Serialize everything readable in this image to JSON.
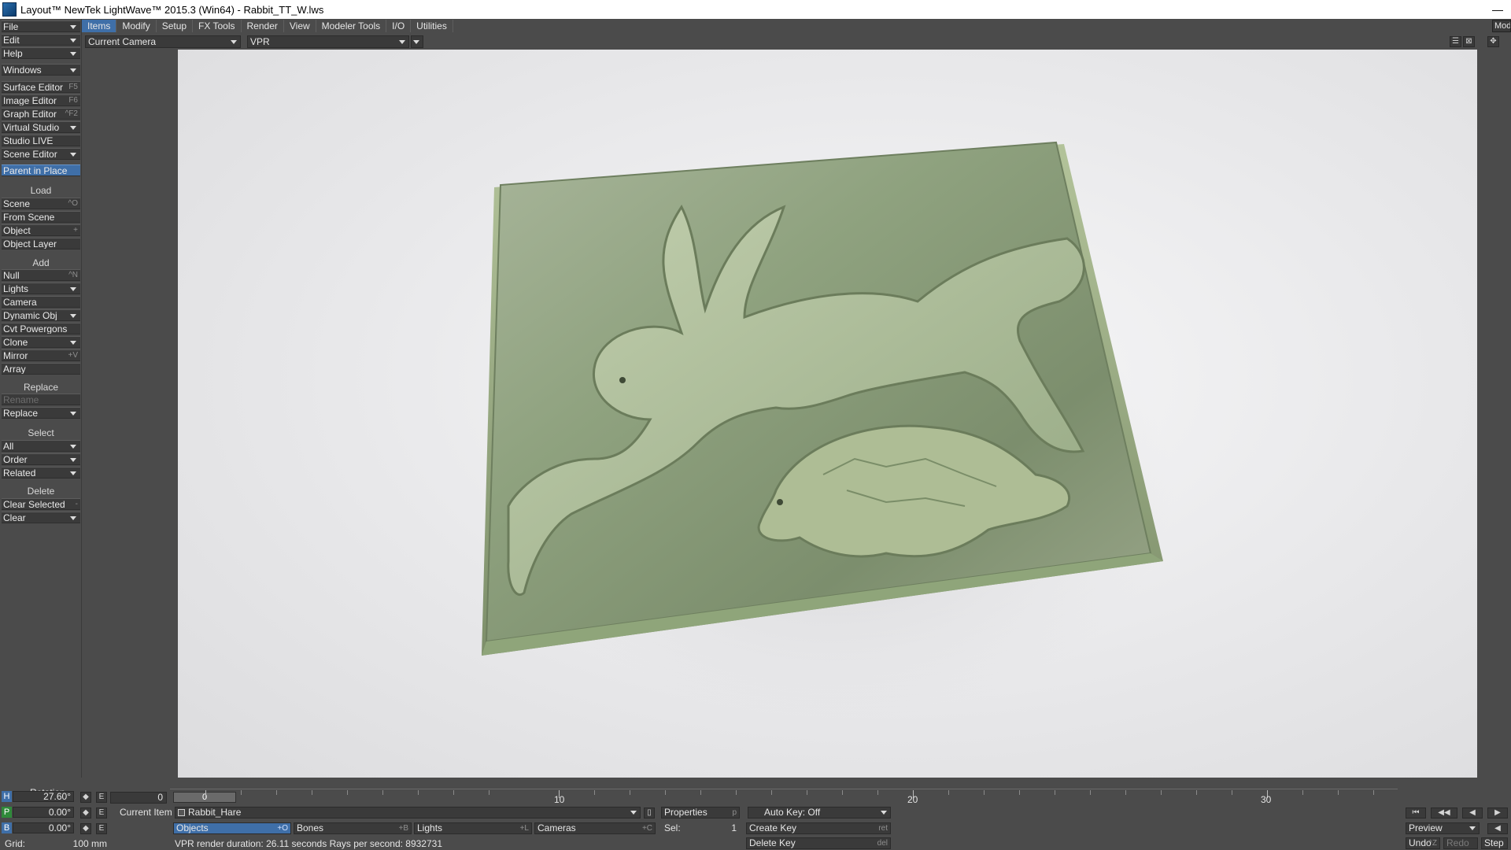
{
  "window": {
    "title": "Layout™ NewTek LightWave™ 2015.3 (Win64) - Rabbit_TT_W.lws",
    "minimize": "—"
  },
  "left_panel": {
    "top_menus": [
      {
        "label": "File"
      },
      {
        "label": "Edit"
      },
      {
        "label": "Help"
      }
    ],
    "windows": {
      "label": "Windows"
    },
    "editors": [
      {
        "label": "Surface Editor",
        "shortcut": "F5"
      },
      {
        "label": "Image Editor",
        "shortcut": "F6"
      },
      {
        "label": "Graph Editor",
        "shortcut": "^F2"
      },
      {
        "label": "Virtual Studio"
      },
      {
        "label": "Studio LIVE"
      },
      {
        "label": "Scene Editor"
      }
    ],
    "parent_in_place": {
      "label": "Parent in Place"
    },
    "load": {
      "header": "Load",
      "items": [
        {
          "label": "Scene",
          "shortcut": "^O"
        },
        {
          "label": "From Scene"
        },
        {
          "label": "Object",
          "shortcut": "+"
        },
        {
          "label": "Object Layer"
        }
      ]
    },
    "add": {
      "header": "Add",
      "items": [
        {
          "label": "Null",
          "shortcut": "^N"
        },
        {
          "label": "Lights"
        },
        {
          "label": "Camera"
        },
        {
          "label": "Dynamic Obj"
        },
        {
          "label": "Cvt Powergons"
        },
        {
          "label": "Clone"
        },
        {
          "label": "Mirror",
          "shortcut": "+V"
        },
        {
          "label": "Array"
        }
      ]
    },
    "replace": {
      "header": "Replace",
      "items": [
        {
          "label": "Rename"
        },
        {
          "label": "Replace"
        }
      ]
    },
    "select": {
      "header": "Select",
      "items": [
        {
          "label": "All"
        },
        {
          "label": "Order"
        },
        {
          "label": "Related"
        }
      ]
    },
    "delete": {
      "header": "Delete",
      "items": [
        {
          "label": "Clear Selected",
          "shortcut": "-"
        },
        {
          "label": "Clear"
        }
      ]
    }
  },
  "menu_tabs": [
    {
      "label": "Items"
    },
    {
      "label": "Modify"
    },
    {
      "label": "Setup"
    },
    {
      "label": "FX Tools"
    },
    {
      "label": "Render"
    },
    {
      "label": "View"
    },
    {
      "label": "Modeler Tools"
    },
    {
      "label": "I/O"
    },
    {
      "label": "Utilities"
    }
  ],
  "modeler_button": "Mod",
  "viewport_header": {
    "view_select": "Current Camera",
    "render_mode": "VPR"
  },
  "bottom": {
    "rotation_label": "Rotation",
    "axes": [
      {
        "axis": "H",
        "value": "27.60°",
        "color": "#3f6fa8"
      },
      {
        "axis": "P",
        "value": "0.00°",
        "color": "#2f8a3a"
      },
      {
        "axis": "B",
        "value": "0.00°",
        "color": "#3f6fa8"
      }
    ],
    "key_button": "E",
    "frame_field": "0",
    "timeline": {
      "current": "0",
      "labels": [
        "10",
        "20",
        "30"
      ]
    },
    "current_item_label": "Current Item",
    "current_item": "Rabbit_Hare",
    "properties": {
      "label": "Properties",
      "shortcut": "p"
    },
    "auto_key": "Auto Key: Off",
    "categories": [
      {
        "label": "Objects",
        "shortcut": "+O"
      },
      {
        "label": "Bones",
        "shortcut": "+B"
      },
      {
        "label": "Lights",
        "shortcut": "+L"
      },
      {
        "label": "Cameras",
        "shortcut": "+C"
      }
    ],
    "sel_label": "Sel:",
    "sel_value": "1",
    "create_key": {
      "label": "Create Key",
      "shortcut": "ret"
    },
    "delete_key": {
      "label": "Delete Key",
      "shortcut": "del"
    },
    "grid_label": "Grid:",
    "grid_value": "100 mm",
    "status": "VPR render duration: 26.11 seconds  Rays per second: 8932731",
    "preview": "Preview",
    "undo": "Undo",
    "undo_shortcut": "^Z",
    "redo": "Redo",
    "step": "Step"
  }
}
